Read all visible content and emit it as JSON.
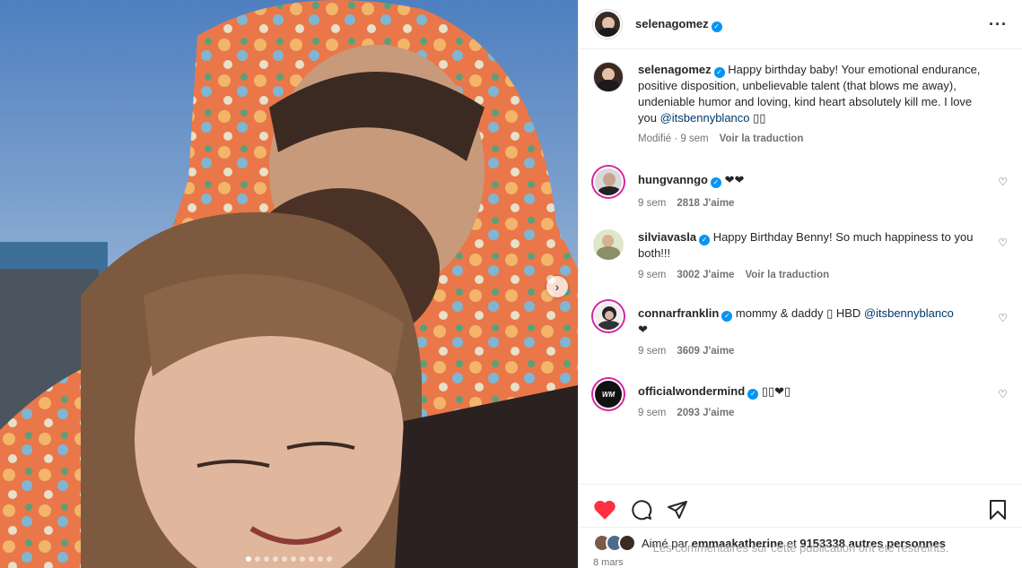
{
  "header": {
    "username": "selenagomez",
    "verified": true,
    "more_icon": "more-horizontal-icon"
  },
  "caption": {
    "username": "selenagomez",
    "text": "Happy birthday baby! Your emotional endurance, positive disposition, unbelievable talent (that blows me away), undeniable humor and loving, kind heart absolutely kill me. I love you ",
    "mention": "@itsbennyblanco",
    "trail": "▯▯",
    "edited": "Modifié",
    "time": "9 sem",
    "translate": "Voir la traduction"
  },
  "comments": [
    {
      "username": "hungvanngo",
      "text": "❤❤",
      "mention": "",
      "time": "9 sem",
      "likes": "2818 J'aime",
      "translate": ""
    },
    {
      "username": "silviavasla",
      "text": "Happy Birthday Benny! So much happiness to you both!!!",
      "mention": "",
      "time": "9 sem",
      "likes": "3002 J'aime",
      "translate": "Voir la traduction"
    },
    {
      "username": "connarfranklin",
      "text": "mommy & daddy ▯ HBD ",
      "mention": "@itsbennyblanco",
      "text2": "❤",
      "time": "9 sem",
      "likes": "3609 J'aime",
      "translate": ""
    },
    {
      "username": "officialwondermind",
      "text": "▯▯❤▯",
      "mention": "",
      "time": "9 sem",
      "likes": "2093 J'aime",
      "translate": ""
    }
  ],
  "likes": {
    "prefix": "Aimé par ",
    "user": "emmaakatherine",
    "middle": " et ",
    "count": "9153338 autres personnes"
  },
  "post_date": "8 mars",
  "restricted": "Les commentaires sur cette publication ont été restreints.",
  "carousel": {
    "total": 10,
    "active": 0
  },
  "colors": {
    "accent": "#0095f6",
    "like": "#ff3040",
    "text": "#262626",
    "secondary": "#737373"
  }
}
